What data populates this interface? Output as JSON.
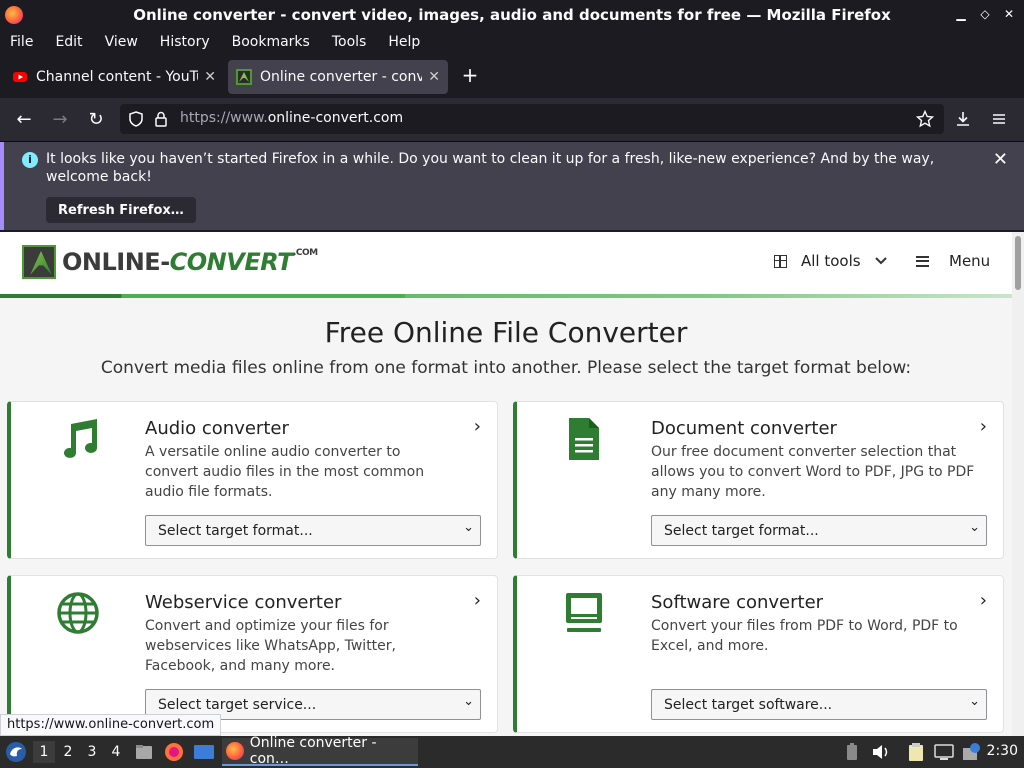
{
  "window": {
    "title": "Online converter - convert video, images, audio and documents for free — Mozilla Firefox"
  },
  "menubar": {
    "items": [
      "File",
      "Edit",
      "View",
      "History",
      "Bookmarks",
      "Tools",
      "Help"
    ]
  },
  "tabs": [
    {
      "label": "Channel content - YouTube",
      "active": false
    },
    {
      "label": "Online converter - convert",
      "active": true
    }
  ],
  "navbar": {
    "url_dim": "https://www.",
    "url_host": "online-convert.com"
  },
  "notification": {
    "message": "It looks like you haven’t started Firefox in a while. Do you want to clean it up for a fresh, like-new experience? And by the way, welcome back!",
    "button": "Refresh Firefox…"
  },
  "site": {
    "logo_main": "ONLINE-",
    "logo_accent": "CONVERT",
    "logo_suffix": ".COM",
    "all_tools": "All tools",
    "menu": "Menu",
    "title": "Free Online File Converter",
    "subtitle": "Convert media files online from one format into another. Please select the target format below:",
    "cards": [
      {
        "title": "Audio converter",
        "desc": "A versatile online audio converter to convert audio files in the most common audio file formats.",
        "select": "Select target format...",
        "icon": "music-note-icon"
      },
      {
        "title": "Document converter",
        "desc": "Our free document converter selection that allows you to convert Word to PDF, JPG to PDF any many more.",
        "select": "Select target format...",
        "icon": "document-icon"
      },
      {
        "title": "Webservice converter",
        "desc": "Convert and optimize your files for webservices like WhatsApp, Twitter, Facebook, and many more.",
        "select": "Select target service...",
        "icon": "globe-icon"
      },
      {
        "title": "Software converter",
        "desc": "Convert your files from PDF to Word, PDF to Excel, and more.",
        "select": "Select target software...",
        "icon": "monitor-icon"
      }
    ]
  },
  "status_url": "https://www.online-convert.com",
  "taskbar": {
    "workspaces": [
      "1",
      "2",
      "3",
      "4"
    ],
    "task_label": "Online converter - con…",
    "clock": "2:30"
  }
}
